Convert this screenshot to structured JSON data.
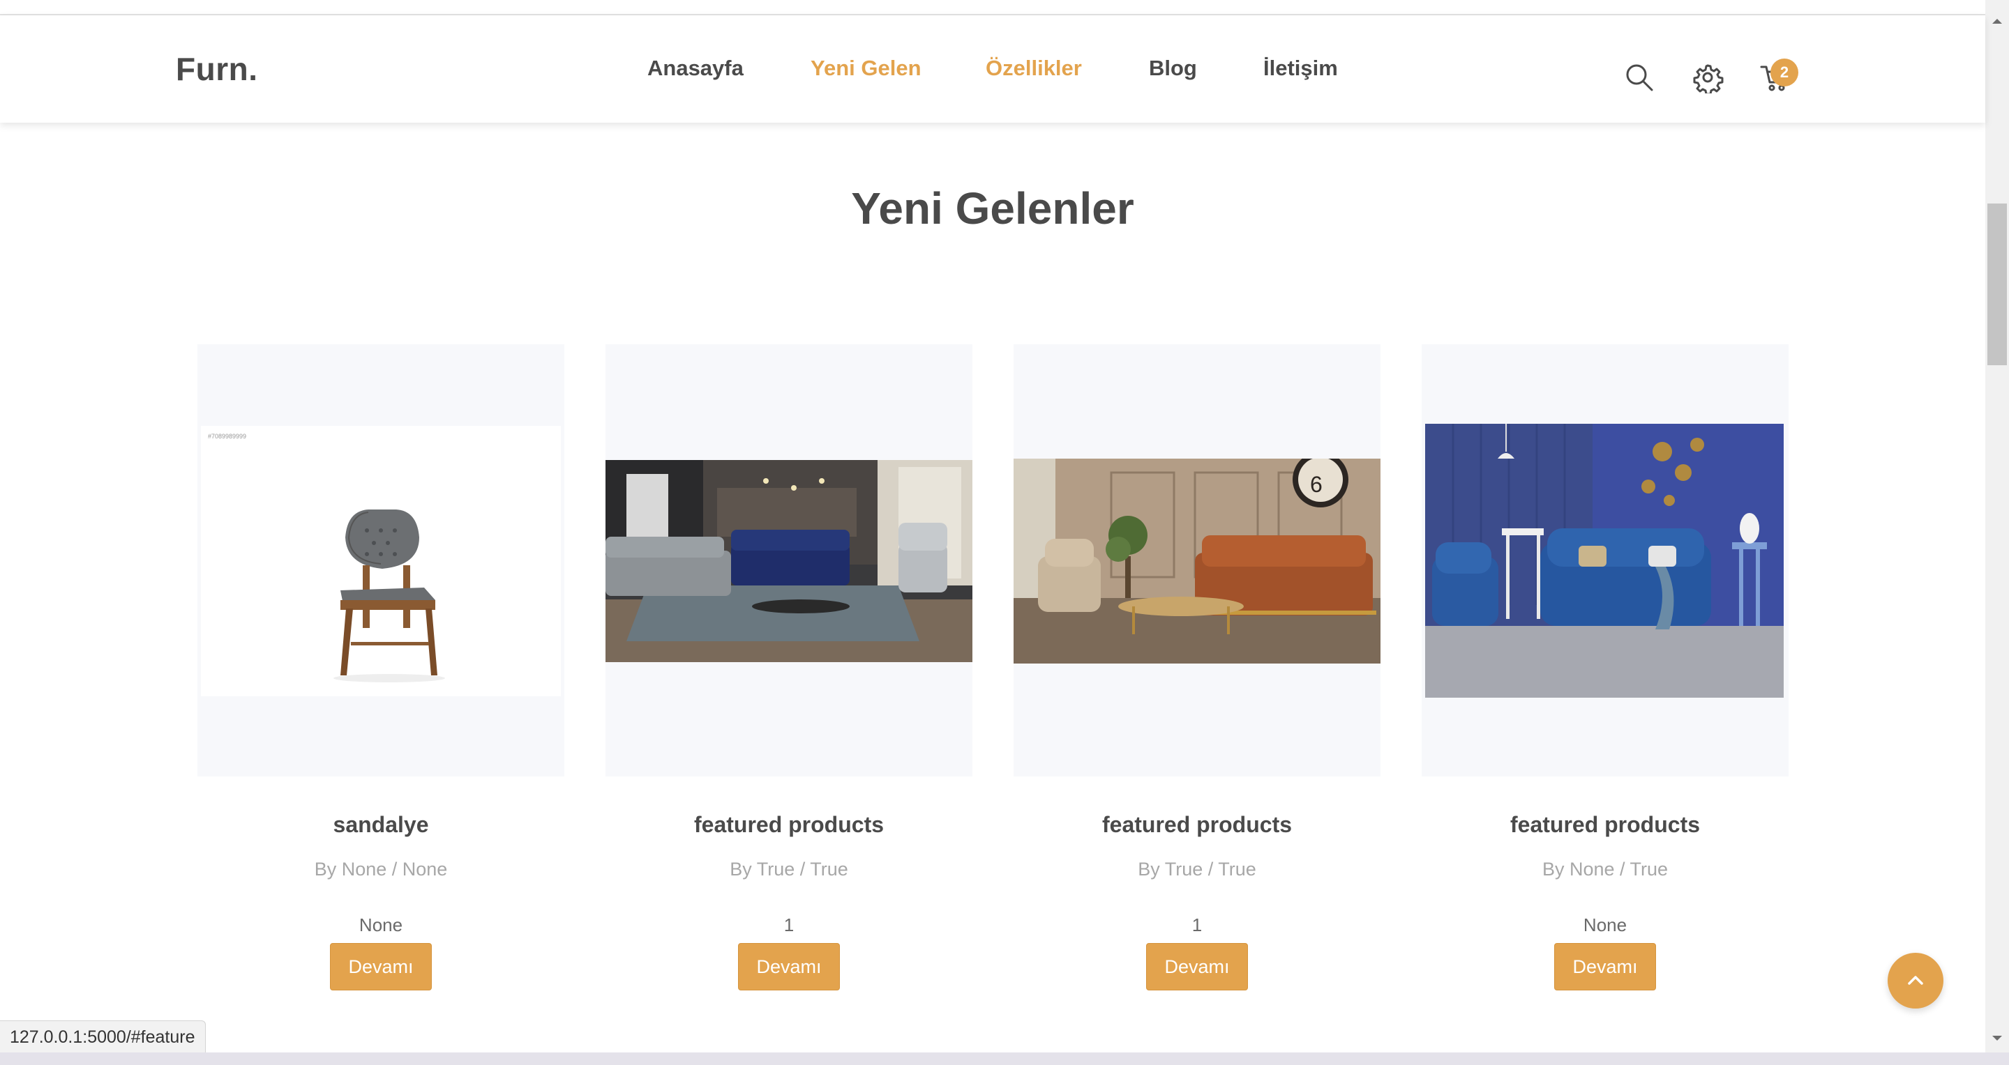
{
  "brand": {
    "logo": "Furn.",
    "accent": "#e3a34d",
    "text": "#4a4a4a"
  },
  "nav": {
    "items": [
      {
        "label": "Anasayfa",
        "active": false
      },
      {
        "label": "Yeni Gelen",
        "active": true
      },
      {
        "label": "Özellikler",
        "active": true
      },
      {
        "label": "Blog",
        "active": false
      },
      {
        "label": "İletişim",
        "active": false
      }
    ]
  },
  "header_icons": {
    "search": "search-icon",
    "settings": "gear-icon",
    "cart": "cart-icon",
    "cart_count": "2"
  },
  "section": {
    "title": "Yeni Gelenler"
  },
  "products": [
    {
      "name": "sandalye",
      "meta": "By None / None",
      "price": "None",
      "button": "Devamı",
      "image": "chair-image",
      "image_label": "#7089989999"
    },
    {
      "name": "featured products",
      "meta": "By True / True",
      "price": "1",
      "button": "Devamı",
      "image": "living-room-blue-sofa-image"
    },
    {
      "name": "featured products",
      "meta": "By True / True",
      "price": "1",
      "button": "Devamı",
      "image": "classic-orange-sofa-image"
    },
    {
      "name": "featured products",
      "meta": "By None / True",
      "price": "None",
      "button": "Devamı",
      "image": "blue-chesterfield-sofa-image"
    }
  ],
  "back_to_top": "chevron-up-icon",
  "status_bar": {
    "url": "127.0.0.1:5000/#feature"
  }
}
